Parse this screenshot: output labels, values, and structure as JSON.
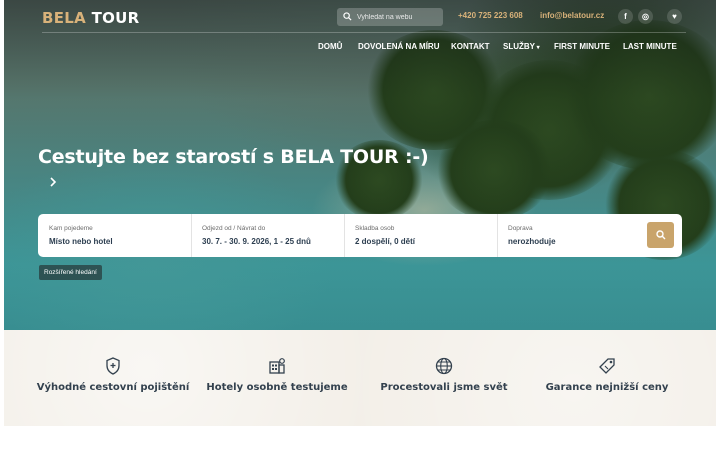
{
  "header": {
    "logo_part1": "BELA",
    "logo_part2": "TOUR",
    "search_placeholder": "Vyhledat na webu",
    "phone": "+420 725 223 608",
    "email": "info@belatour.cz",
    "social": [
      {
        "icon": "facebook-icon",
        "glyph": "f"
      },
      {
        "icon": "instagram-icon",
        "glyph": "◎"
      },
      {
        "icon": "heart-icon",
        "glyph": "♥"
      }
    ]
  },
  "nav": [
    {
      "label": "DOMŮ"
    },
    {
      "label": "DOVOLENÁ NA MÍRU"
    },
    {
      "label": "KONTAKT"
    },
    {
      "label": "SLUŽBY"
    },
    {
      "label": "FIRST MINUTE"
    },
    {
      "label": "LAST MINUTE"
    }
  ],
  "hero": {
    "headline": "Cestujte bez starostí s BELA TOUR :-)"
  },
  "search_form": {
    "fields": [
      {
        "label": "Kam pojedeme",
        "value": "Místo nebo hotel"
      },
      {
        "label": "Odjezd od / Návrat do",
        "value": "30. 7. - 30. 9. 2026, 1 - 25 dnů"
      },
      {
        "label": "Skladba osob",
        "value": "2 dospělí, 0 dětí"
      },
      {
        "label": "Doprava",
        "value": "nerozhoduje"
      }
    ],
    "advanced_label": "Rozšířené hledání"
  },
  "features": [
    {
      "icon": "shield-plus-icon",
      "label": "Výhodné cestovní pojištění"
    },
    {
      "icon": "hotel-icon",
      "label": "Hotely osobně testujeme"
    },
    {
      "icon": "globe-icon",
      "label": "Procestovali jsme svět"
    },
    {
      "icon": "price-tag-icon",
      "label": "Garance nejnižší ceny"
    }
  ],
  "colors": {
    "accent": "#d9b27a",
    "button": "#c9a46b",
    "dark_text": "#33414e"
  }
}
